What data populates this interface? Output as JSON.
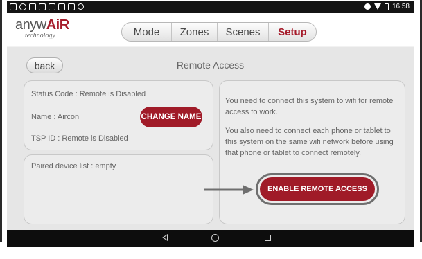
{
  "status_bar": {
    "time": "16:58",
    "icons_left": [
      "notification-icon",
      "sync-icon",
      "image-icon",
      "image-icon",
      "image-icon",
      "image-icon",
      "image-icon",
      "info-icon"
    ],
    "icons_right": [
      "alarm-icon",
      "wifi-icon",
      "battery-icon"
    ]
  },
  "header": {
    "logo": {
      "brand_prefix": "anyw",
      "brand_suffix": "AiR",
      "tagline": "technology"
    },
    "tabs": [
      {
        "label": "Mode",
        "active": false
      },
      {
        "label": "Zones",
        "active": false
      },
      {
        "label": "Scenes",
        "active": false
      },
      {
        "label": "Setup",
        "active": true
      }
    ]
  },
  "main": {
    "back_label": "back",
    "title": "Remote Access",
    "status_panel": {
      "status_code": "Status Code : Remote is Disabled",
      "name": "Name : Aircon",
      "change_name_label": "CHANGE NAME",
      "tsp_id": "TSP ID : Remote is Disabled"
    },
    "paired_panel": {
      "paired_list": "Paired device list : empty"
    },
    "info_panel": {
      "paragraph_1": "You need to connect this system to wifi for remote access to work.",
      "paragraph_2": "You also need to connect each phone or tablet to this system on the same wifi network before using that phone or tablet to connect remotely.",
      "enable_label": "ENABLE REMOTE ACCESS"
    }
  },
  "nav_bar": {
    "icons": [
      "back-icon",
      "home-icon",
      "recents-icon"
    ]
  },
  "colors": {
    "accent": "#a01b28",
    "status_bar": "#141414",
    "background": "#e6e6e6",
    "annotation_arrow": "#6f6f6f"
  }
}
